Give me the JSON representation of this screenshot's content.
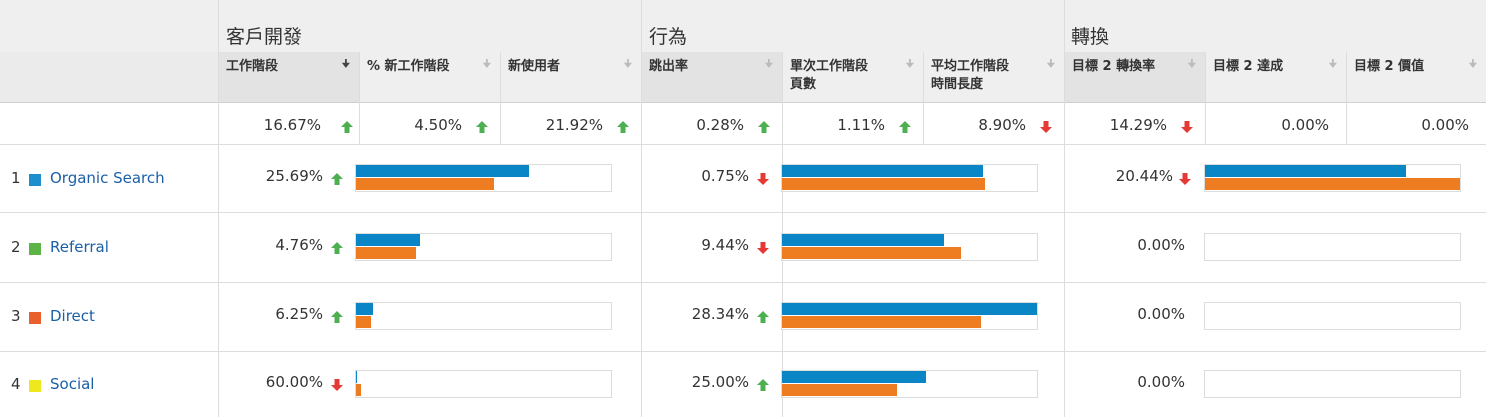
{
  "groups": {
    "acquisition": "客戶開發",
    "behavior": "行為",
    "conversion": "轉換"
  },
  "columns": {
    "sessions": "工作階段",
    "new_sessions": "% 新工作階段",
    "new_users": "新使用者",
    "bounce_rate": "跳出率",
    "pages_per_session_1": "單次工作階段",
    "pages_per_session_2": "頁數",
    "avg_duration_1": "平均工作階段",
    "avg_duration_2": "時間長度",
    "goal2_rate": "目標 2 轉換率",
    "goal2_completions": "目標 2 達成",
    "goal2_value": "目標 2 價值"
  },
  "totals": {
    "sessions": "16.67%",
    "new_sessions": "4.50%",
    "new_users": "21.92%",
    "bounce_rate": "0.28%",
    "pages_per_session": "1.11%",
    "avg_duration": "8.90%",
    "goal2_rate": "14.29%",
    "goal2_completions": "0.00%",
    "goal2_value": "0.00%"
  },
  "rows": [
    {
      "num": "1",
      "channel": "Organic Search",
      "swatch": "#1f8fce",
      "sessions": "25.69%",
      "bounce": "0.75%",
      "goal": "20.44%",
      "bar_sessions": [
        0.68,
        0.54
      ],
      "bar_pages": [
        0.79,
        0.795
      ],
      "bar_goal": [
        0.79,
        1.0
      ]
    },
    {
      "num": "2",
      "channel": "Referral",
      "swatch": "#5db346",
      "sessions": "4.76%",
      "bounce": "9.44%",
      "goal": "0.00%",
      "bar_sessions": [
        0.25,
        0.235
      ],
      "bar_pages": [
        0.635,
        0.7
      ],
      "bar_goal": [
        0,
        0
      ]
    },
    {
      "num": "3",
      "channel": "Direct",
      "swatch": "#e8602c",
      "sessions": "6.25%",
      "bounce": "28.34%",
      "goal": "0.00%",
      "bar_sessions": [
        0.065,
        0.06
      ],
      "bar_pages": [
        1.0,
        0.78
      ],
      "bar_goal": [
        0,
        0
      ]
    },
    {
      "num": "4",
      "channel": "Social",
      "swatch": "#f0e81e",
      "sessions": "60.00%",
      "bounce": "25.00%",
      "goal": "0.00%",
      "bar_sessions": [
        0.005,
        0.02
      ],
      "bar_pages": [
        0.565,
        0.45
      ],
      "bar_goal": [
        0,
        0
      ]
    }
  ],
  "colors": {
    "up": "#4caf50",
    "down": "#e53935",
    "bar_blue": "#0a86c6",
    "bar_orange": "#ee7d22",
    "link": "#1a5fa8"
  }
}
